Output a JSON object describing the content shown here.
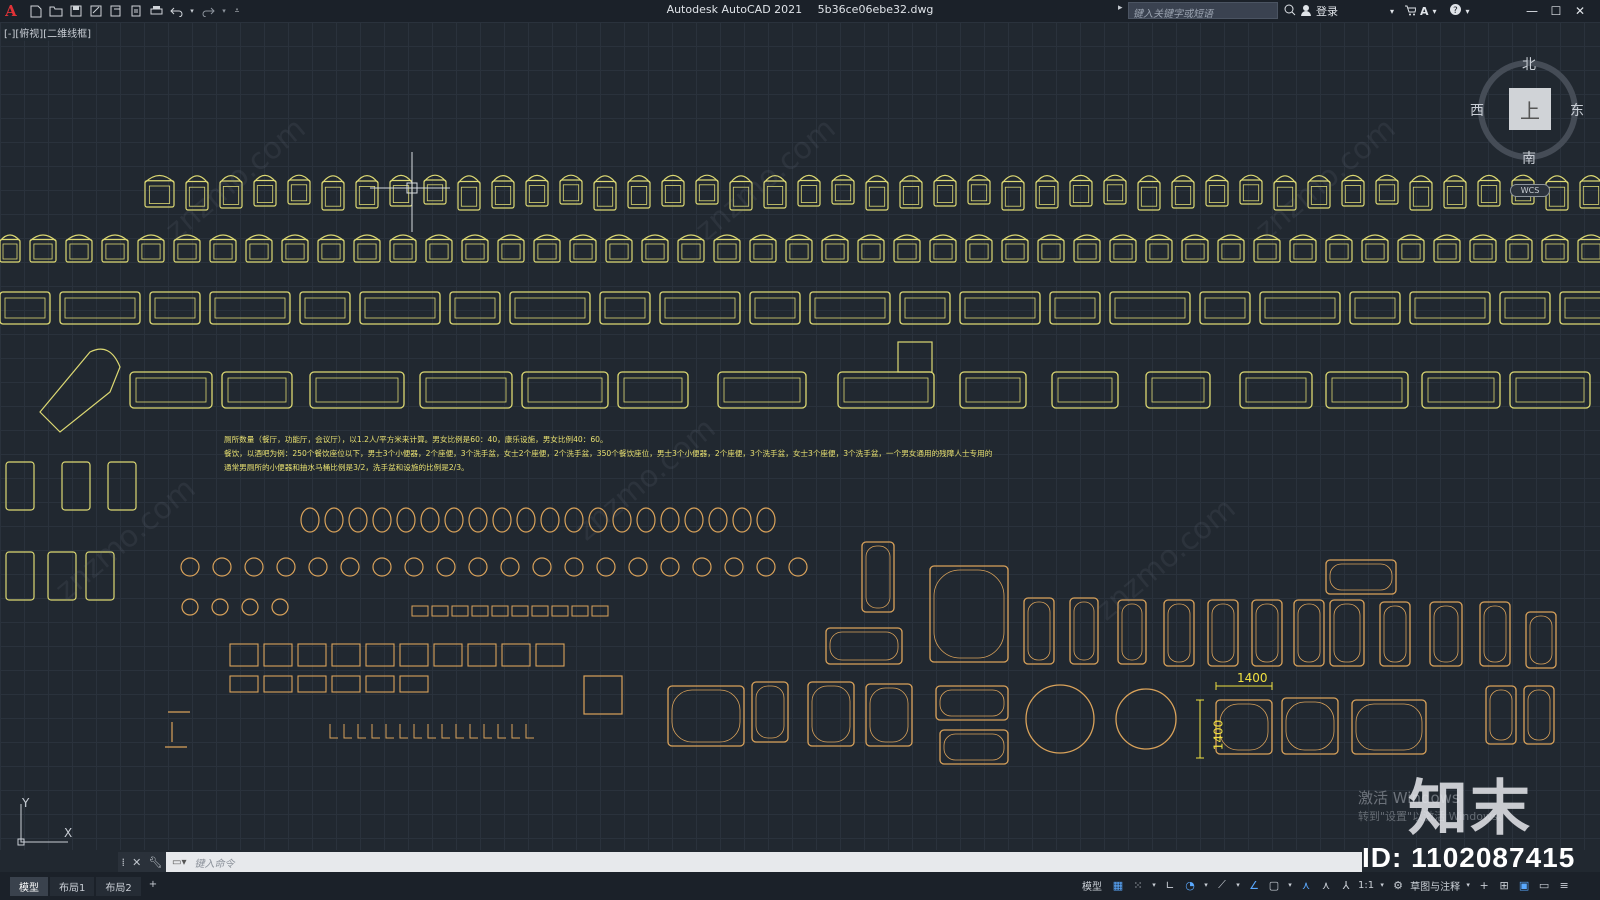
{
  "titlebar": {
    "app_name": "Autodesk AutoCAD 2021",
    "file_name": "5b36ce06ebe32.dwg",
    "search_placeholder": "键入关键字或短语",
    "signin_label": "登录"
  },
  "viewport_label": "[-][俯视][二维线框]",
  "viewcube": {
    "north": "北",
    "south": "南",
    "east": "东",
    "west": "西",
    "top_face": "上",
    "wcs": "WCS"
  },
  "notes": [
    "厕所数量（餐厅，功能厅，会议厅），以1.2人/平方米来计算。男女比例是60：40，康乐设施，男女比例40：60。",
    "餐饮，以酒吧为例：250个餐饮座位以下，男士3个小便器，2个座便，3个洗手盆，女士2个座便，2个洗手盆，350个餐饮座位，男士3个小便器，2个座便，3个洗手盆，女士3个座便，3个洗手盆，一个男女通用的残障人士专用的",
    "通常男厕所的小便器和抽水马桶比例是3/2，洗手盆和设施的比例是2/3。"
  ],
  "dimensions": {
    "horizontal": "1400",
    "vertical": "1400"
  },
  "ucs": {
    "x": "X",
    "y": "Y"
  },
  "activation": {
    "line1": "激活 Windows",
    "line2": "转到\"设置\"以激活 Windows。"
  },
  "brand": {
    "logo": "知末",
    "id": "ID: 1102087415"
  },
  "command": {
    "placeholder": "键入命令"
  },
  "layout_tabs": {
    "model": "模型",
    "layout1": "布局1",
    "layout2": "布局2",
    "add": "+"
  },
  "status": {
    "model": "模型",
    "scale": "1:1",
    "annotation": "草图与注释"
  },
  "colors": {
    "furniture": "#dcd872",
    "fixtures": "#d9a25a",
    "note": "#e8e070",
    "dimension": "#f0e040",
    "background": "#212830"
  }
}
